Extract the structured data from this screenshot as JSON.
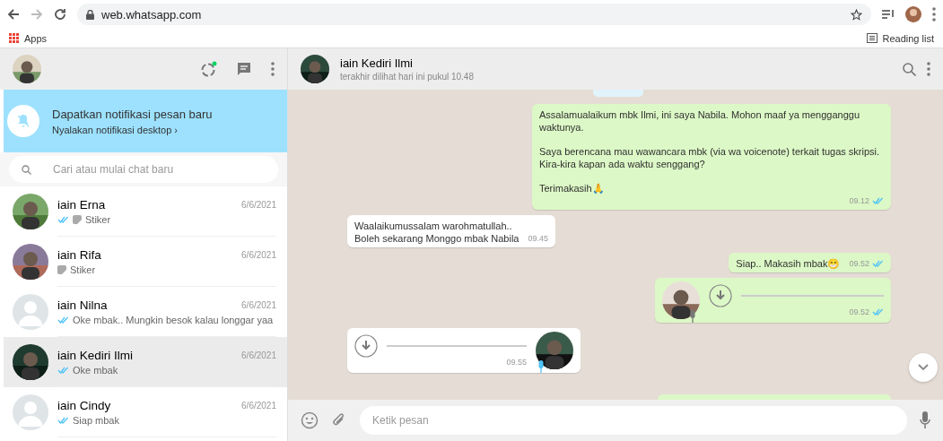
{
  "browser": {
    "url": "web.whatsapp.com",
    "bookmarks": [
      {
        "label": "Apps"
      }
    ],
    "reading_list": "Reading list"
  },
  "sidebar": {
    "notification": {
      "title": "Dapatkan notifikasi pesan baru",
      "link": "Nyalakan notifikasi desktop ›"
    },
    "search": {
      "placeholder": "Cari atau mulai chat baru"
    },
    "chats": [
      {
        "name": "iain Erna",
        "date": "6/6/2021",
        "preview": "Stiker",
        "read_ticks": true,
        "sticker": true,
        "selected": false
      },
      {
        "name": "iain Rifa",
        "date": "6/6/2021",
        "preview": "Stiker",
        "read_ticks": false,
        "sticker": true,
        "selected": false
      },
      {
        "name": "iain Nilna",
        "date": "6/6/2021",
        "preview": "Oke mbak.. Mungkin besok kalau longgar yaa",
        "read_ticks": true,
        "sticker": false,
        "avatar": {
          "kind": "default"
        },
        "selected": false
      },
      {
        "name": "iain Kediri Ilmi",
        "date": "6/6/2021",
        "preview": "Oke mbak",
        "read_ticks": true,
        "sticker": false,
        "selected": true
      },
      {
        "name": "iain Cindy",
        "date": "6/6/2021",
        "preview": "Siap mbak",
        "read_ticks": true,
        "sticker": false,
        "avatar": {
          "kind": "default"
        },
        "selected": false
      }
    ]
  },
  "conversation": {
    "contact": "iain Kediri Ilmi",
    "last_seen": "terakhir dilihat hari ini pukul 10.48",
    "messages": [
      {
        "kind": "text",
        "outgoing": true,
        "lines": [
          "Assalamualaikum mbk Ilmi, ini saya Nabila. Mohon maaf ya mengganggu waktunya.",
          "Saya berencana mau wawancara mbk (via wa voicenote) terkait tugas skripsi. Kira-kira kapan ada waktu senggang?",
          "Terimakasih🙏"
        ],
        "time": "09.12",
        "read": true
      },
      {
        "kind": "text",
        "outgoing": false,
        "lines": [
          "Waalaikumussalam warohmatullah..\nBoleh sekarang Monggo mbak Nabila"
        ],
        "time": "09.45"
      },
      {
        "kind": "text",
        "outgoing": true,
        "lines": [
          "Siap.. Makasih mbak😁"
        ],
        "time": "09.52",
        "read": true
      },
      {
        "kind": "voice",
        "outgoing": true,
        "time": "09.52",
        "read": true
      },
      {
        "kind": "voice",
        "outgoing": false,
        "time": "09.55"
      }
    ],
    "composer": {
      "placeholder": "Ketik pesan"
    }
  }
}
